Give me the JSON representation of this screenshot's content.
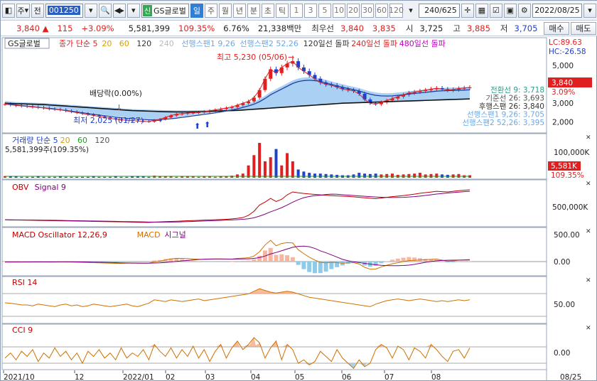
{
  "toolbar": {
    "type_select": "주",
    "prev_btn": "전",
    "code": "001250",
    "stock_tag": "신",
    "stock_name": "GS글로벌",
    "periods": [
      "일",
      "주",
      "월",
      "년",
      "분",
      "초",
      "틱"
    ],
    "active_period": "일",
    "period_nums": [
      "1",
      "3",
      "5",
      "10",
      "20",
      "30",
      "60",
      "120"
    ],
    "count": "240",
    "count_total": "/625",
    "date": "2022/08/25"
  },
  "quote": {
    "price": "3,840",
    "arrow": "▲",
    "change": "115",
    "change_pct": "+3.09%",
    "volume": "5,581,399",
    "volume_ratio": "109.35%",
    "turnover": "6.76%",
    "amount": "21,338백만",
    "preferred_label": "최우선",
    "ask": "3,840",
    "bid": "3,835",
    "open_label": "시",
    "open": "3,725",
    "high_label": "고",
    "high": "3,885",
    "low_label": "저",
    "low": "3,705",
    "buy": "매수",
    "sell": "매도"
  },
  "price_panel": {
    "stock_label": "GS글로벌",
    "legend": [
      {
        "text": "종가 단순 5",
        "color": "#e02020"
      },
      {
        "text": "20",
        "color": "#d9a000"
      },
      {
        "text": "60",
        "color": "#d9a000"
      },
      {
        "text": "120",
        "color": "#333333"
      },
      {
        "text": "240",
        "color": "#bbbbbb"
      },
      {
        "text": "선행스팬1 9,26",
        "color": "#6aa8e8"
      },
      {
        "text": "선행스팬2 52,26",
        "color": "#6aa8e8"
      },
      {
        "text": "120일선 돌파",
        "color": "#333333"
      },
      {
        "text": "240일선 돌파",
        "color": "#e02020"
      },
      {
        "text": "480일선 돌파",
        "color": "#c000c0"
      }
    ],
    "max_label": "최고 5,230 (05/06)",
    "min_label": "최저 2,025 (01/27)",
    "dividend_label": "배당락(0.00%)",
    "lc": "LC:89.63",
    "hc": "HC:-26.58",
    "axis_ticks": [
      "5,000",
      "4,000",
      "3,000",
      "2,000"
    ],
    "current_price": "3,840",
    "current_pct": "3.09%",
    "ichimoku": [
      "전환선 9: 3,718",
      "기준선 26: 3,693",
      "후행스팬 26: 3,840",
      "선행스팬1 9,26: 3,705",
      "선행스팬2 52,26: 3,395"
    ]
  },
  "volume_panel": {
    "legend": [
      {
        "text": "거래량 단순 5",
        "color": "#1e40d0"
      },
      {
        "text": "20",
        "color": "#d9a000"
      },
      {
        "text": "60",
        "color": "#20a020"
      },
      {
        "text": "120",
        "color": "#555555"
      }
    ],
    "value": "5,581,399주(109.35%)",
    "axis_tick": "100,000K",
    "current": "5,581K",
    "current_pct": "109.35%"
  },
  "obv_panel": {
    "legend": [
      {
        "text": "OBV",
        "color": "#c00000"
      },
      {
        "text": "Signal 9",
        "color": "#800080"
      }
    ],
    "axis_tick": "500,000K"
  },
  "macd_panel": {
    "legend": [
      {
        "text": "MACD Oscillator 12,26,9",
        "color": "#c00000"
      },
      {
        "text": "MACD",
        "color": "#d07000"
      },
      {
        "text": "시그널",
        "color": "#800080"
      }
    ],
    "axis_ticks": [
      "500.00",
      "0.00"
    ]
  },
  "rsi_panel": {
    "legend": [
      {
        "text": "RSI 14",
        "color": "#c00000"
      }
    ],
    "axis_tick": "50.00"
  },
  "cci_panel": {
    "legend": [
      {
        "text": "CCI 9",
        "color": "#c00000"
      }
    ],
    "axis_tick": "0.00"
  },
  "x_axis": {
    "labels": [
      "2021/10",
      "12",
      "2022/01",
      "02",
      "03",
      "04",
      "05",
      "06",
      "07",
      "08"
    ],
    "end_label": "08/25"
  },
  "chart_data": {
    "type": "line",
    "x_labels": [
      "2021/10",
      "12",
      "2022/01",
      "02",
      "03",
      "04",
      "05",
      "06",
      "07",
      "08"
    ],
    "price_ylim": [
      1500,
      5800
    ],
    "close": [
      2950,
      2920,
      2880,
      2860,
      2830,
      2800,
      2780,
      2750,
      2700,
      2680,
      2650,
      2600,
      2550,
      2500,
      2450,
      2400,
      2350,
      2300,
      2250,
      2200,
      2150,
      2120,
      2100,
      2080,
      2060,
      2040,
      2025,
      2100,
      2150,
      2250,
      2350,
      2420,
      2450,
      2480,
      2500,
      2520,
      2550,
      2600,
      2650,
      2700,
      2750,
      2800,
      2900,
      3000,
      3100,
      3300,
      3700,
      4300,
      4800,
      4600,
      4900,
      5100,
      5230,
      4900,
      4700,
      4500,
      4300,
      4100,
      4000,
      3950,
      3850,
      3750,
      3700,
      3650,
      3500,
      3200,
      3000,
      2950,
      3050,
      3150,
      3250,
      3350,
      3450,
      3550,
      3600,
      3650,
      3700,
      3750,
      3800,
      3750,
      3700,
      3725,
      3780,
      3810,
      3840
    ],
    "ma20": [
      2980,
      2950,
      2910,
      2880,
      2850,
      2820,
      2790,
      2760,
      2730,
      2700,
      2660,
      2620,
      2580,
      2540,
      2500,
      2460,
      2420,
      2380,
      2340,
      2300,
      2260,
      2230,
      2200,
      2180,
      2160,
      2140,
      2120,
      2120,
      2130,
      2150,
      2180,
      2210,
      2250,
      2290,
      2330,
      2370,
      2410,
      2450,
      2490,
      2540,
      2590,
      2640,
      2700,
      2780,
      2860,
      2950,
      3080,
      3250,
      3450,
      3600,
      3750,
      3900,
      4050,
      4150,
      4200,
      4220,
      4200,
      4150,
      4080,
      4000,
      3920,
      3850,
      3780,
      3720,
      3650,
      3560,
      3480,
      3420,
      3390,
      3380,
      3390,
      3420,
      3450,
      3490,
      3520,
      3550,
      3580,
      3610,
      3640,
      3660,
      3670,
      3680,
      3690,
      3700,
      3710
    ],
    "ma120": [
      3000,
      2990,
      2980,
      2970,
      2960,
      2950,
      2940,
      2930,
      2910,
      2890,
      2870,
      2850,
      2830,
      2810,
      2790,
      2770,
      2750,
      2730,
      2710,
      2690,
      2670,
      2650,
      2630,
      2610,
      2600,
      2590,
      2580,
      2570,
      2560,
      2550,
      2545,
      2540,
      2540,
      2540,
      2545,
      2550,
      2560,
      2570,
      2580,
      2590,
      2600,
      2610,
      2620,
      2640,
      2660,
      2680,
      2700,
      2720,
      2740,
      2760,
      2780,
      2800,
      2820,
      2840,
      2860,
      2880,
      2900,
      2920,
      2940,
      2960,
      2980,
      3000,
      3010,
      3020,
      3030,
      3040,
      3050,
      3060,
      3070,
      3080,
      3090,
      3100,
      3110,
      3120,
      3130,
      3140,
      3150,
      3160,
      3170,
      3180,
      3190,
      3200,
      3210,
      3220,
      3230
    ],
    "volume_k": [
      4,
      3,
      3,
      2,
      2,
      2,
      3,
      2,
      2,
      2,
      3,
      2,
      2,
      2,
      2,
      2,
      3,
      2,
      2,
      2,
      3,
      2,
      2,
      3,
      4,
      3,
      2,
      5,
      4,
      3,
      3,
      2,
      3,
      4,
      3,
      2,
      3,
      3,
      2,
      3,
      4,
      5,
      8,
      10,
      30,
      55,
      85,
      40,
      50,
      70,
      30,
      60,
      40,
      20,
      15,
      12,
      10,
      10,
      9,
      8,
      7,
      6,
      6,
      8,
      12,
      10,
      9,
      10,
      8,
      9,
      10,
      7,
      8,
      9,
      10,
      12,
      8,
      9,
      10,
      8,
      7,
      8,
      9,
      6,
      6
    ],
    "rsi": [
      45,
      44,
      42,
      40,
      40,
      38,
      42,
      40,
      38,
      36,
      40,
      42,
      38,
      40,
      36,
      38,
      42,
      40,
      38,
      36,
      38,
      40,
      42,
      38,
      36,
      40,
      44,
      52,
      50,
      48,
      52,
      50,
      48,
      50,
      52,
      54,
      50,
      52,
      54,
      56,
      58,
      60,
      62,
      64,
      66,
      72,
      78,
      74,
      70,
      68,
      70,
      72,
      70,
      66,
      62,
      58,
      56,
      54,
      52,
      50,
      48,
      46,
      44,
      42,
      40,
      38,
      36,
      42,
      46,
      50,
      52,
      54,
      52,
      50,
      52,
      54,
      52,
      50,
      48,
      50,
      48,
      50,
      52,
      50,
      52
    ],
    "cci": [
      -40,
      20,
      -60,
      40,
      -20,
      60,
      -80,
      20,
      -40,
      80,
      -20,
      40,
      -60,
      20,
      -100,
      40,
      -20,
      60,
      -40,
      20,
      -60,
      80,
      -40,
      20,
      -20,
      60,
      -60,
      120,
      40,
      -20,
      80,
      -40,
      60,
      -20,
      100,
      -40,
      60,
      -80,
      40,
      120,
      -40,
      80,
      160,
      60,
      120,
      200,
      140,
      -40,
      80,
      160,
      -60,
      120,
      60,
      -100,
      -60,
      -120,
      -80,
      40,
      -20,
      -80,
      60,
      -40,
      -100,
      -160,
      -60,
      -140,
      -100,
      60,
      120,
      80,
      -40,
      100,
      60,
      -60,
      80,
      40,
      -40,
      120,
      60,
      -20,
      -80,
      40,
      60,
      -40,
      80
    ],
    "axis_ranges": {
      "price": [
        1500,
        5800
      ],
      "rsi": [
        0,
        100
      ],
      "cci": [
        -250,
        250
      ]
    }
  }
}
